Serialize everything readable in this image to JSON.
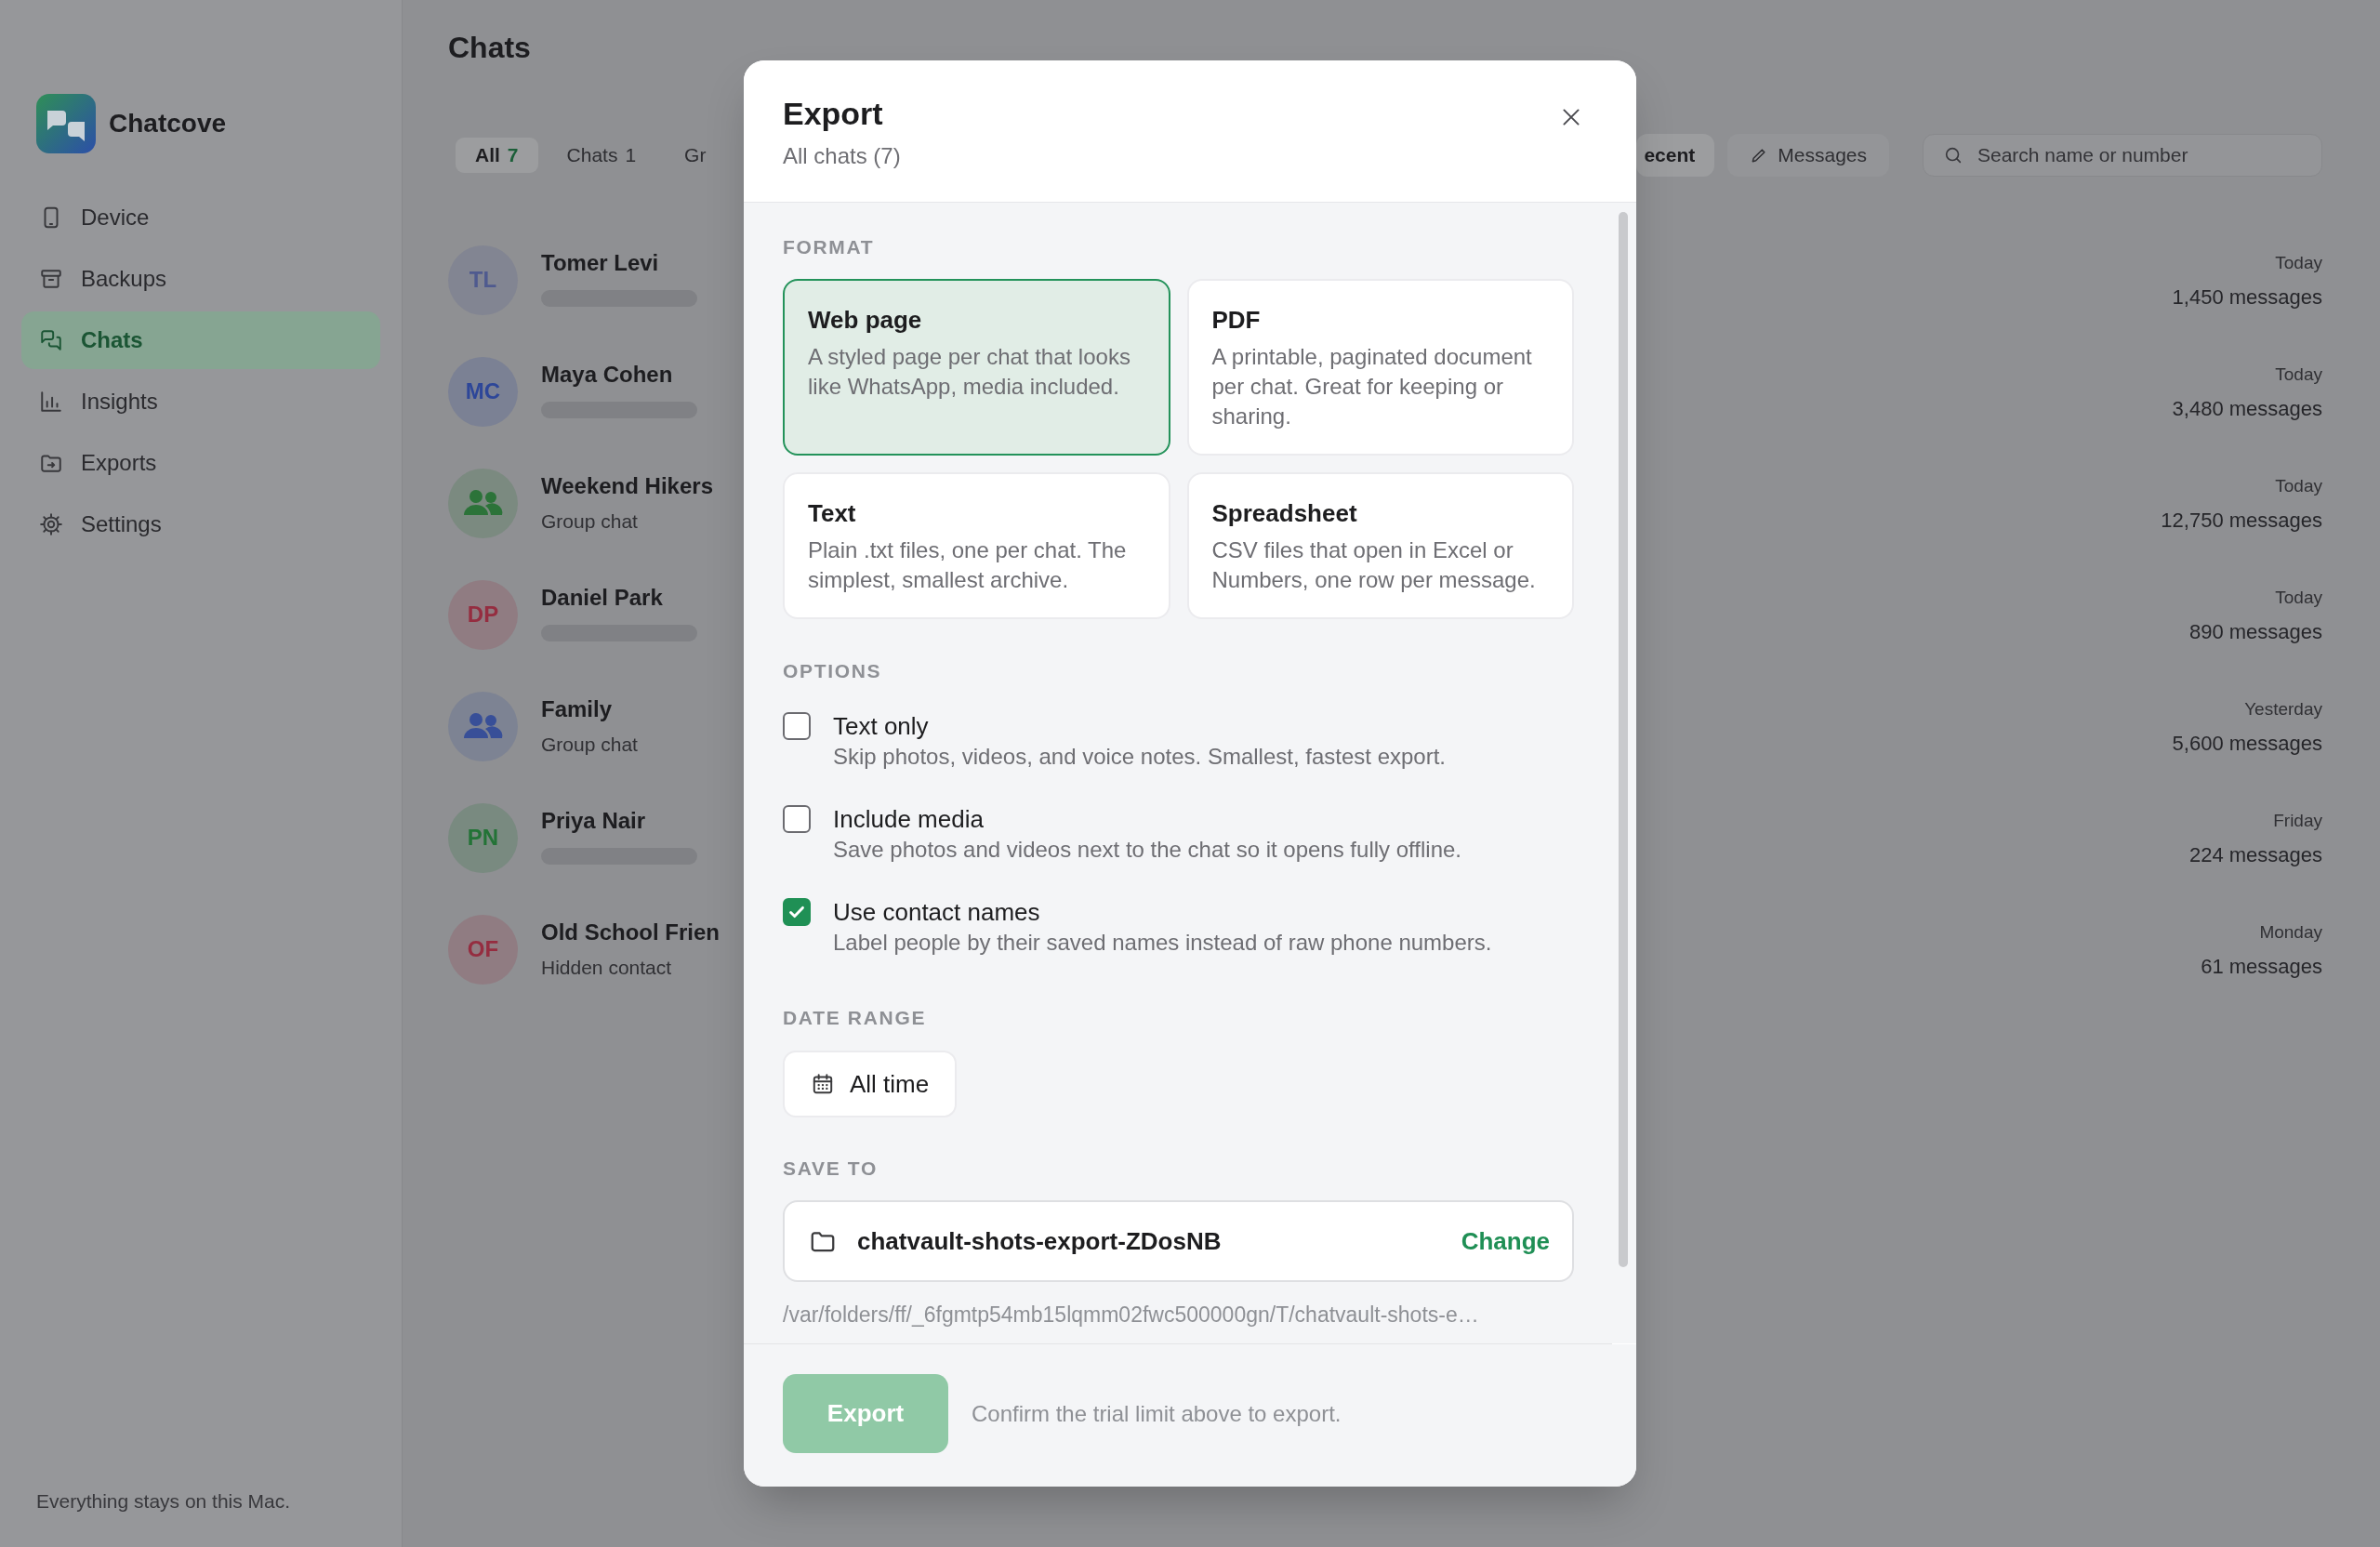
{
  "sidebar": {
    "app_name": "Chatcove",
    "items": [
      {
        "label": "Device",
        "selected": false
      },
      {
        "label": "Backups",
        "selected": false
      },
      {
        "label": "Chats",
        "selected": true
      },
      {
        "label": "Insights",
        "selected": false
      },
      {
        "label": "Exports",
        "selected": false
      },
      {
        "label": "Settings",
        "selected": false
      }
    ],
    "footer": "Everything stays on this Mac."
  },
  "main": {
    "title": "Chats",
    "filters": [
      {
        "label": "All",
        "count": "7",
        "selected": true
      },
      {
        "label": "Chats",
        "count": "1",
        "selected": false
      },
      {
        "label": "Gr",
        "selected": false
      }
    ],
    "sort": [
      {
        "label": "ecent",
        "selected": true
      },
      {
        "label": "Messages",
        "selected": false
      }
    ],
    "search": {
      "placeholder": "Search name or number"
    },
    "chats": [
      {
        "name": "Tomer Levi",
        "avatar": {
          "kind": "initials",
          "text": "TL",
          "color": "#4f5a8f"
        },
        "subtitle": {
          "kind": "blurred"
        },
        "time": "Today",
        "count": "1,450 messages"
      },
      {
        "name": "Maya Cohen",
        "avatar": {
          "kind": "initials",
          "text": "MC",
          "color": "#2d4699"
        },
        "subtitle": {
          "kind": "blurred"
        },
        "time": "Today",
        "count": "3,480 messages"
      },
      {
        "name": "Weekend Hikers",
        "avatar": {
          "kind": "group",
          "color": "#2c7339"
        },
        "subtitle": {
          "kind": "text",
          "text": "Group chat"
        },
        "time": "Today",
        "count": "12,750 messages"
      },
      {
        "name": "Daniel Park",
        "avatar": {
          "kind": "initials",
          "text": "DP",
          "color": "#952d40"
        },
        "subtitle": {
          "kind": "blurred"
        },
        "time": "Today",
        "count": "890 messages"
      },
      {
        "name": "Family",
        "avatar": {
          "kind": "group",
          "color": "#384f98"
        },
        "subtitle": {
          "kind": "text",
          "text": "Group chat"
        },
        "time": "Yesterday",
        "count": "5,600 messages"
      },
      {
        "name": "Priya Nair",
        "avatar": {
          "kind": "initials",
          "text": "PN",
          "color": "#237336"
        },
        "subtitle": {
          "kind": "blurred"
        },
        "time": "Friday",
        "count": "224 messages"
      },
      {
        "name": "Old School Frien",
        "avatar": {
          "kind": "initials",
          "text": "OF",
          "color": "#952d40"
        },
        "subtitle": {
          "kind": "text",
          "text": "Hidden contact"
        },
        "time": "Monday",
        "count": "61 messages"
      }
    ]
  },
  "dialog": {
    "title": "Export",
    "subtitle": "All chats (7)",
    "format": {
      "label": "FORMAT",
      "options": [
        {
          "title": "Web page",
          "description": "A styled page per chat that looks like WhatsApp, media included.",
          "selected": true
        },
        {
          "title": "PDF",
          "description": "A printable, paginated document per chat. Great for keeping or sharing.",
          "selected": false
        },
        {
          "title": "Text",
          "description": "Plain .txt files, one per chat. The simplest, smallest archive.",
          "selected": false
        },
        {
          "title": "Spreadsheet",
          "description": "CSV files that open in Excel or Numbers, one row per message.",
          "selected": false
        }
      ]
    },
    "options": {
      "label": "OPTIONS",
      "items": [
        {
          "label": "Text only",
          "description": "Skip photos, videos, and voice notes. Smallest, fastest export.",
          "checked": false
        },
        {
          "label": "Include media",
          "description": "Save photos and videos next to the chat so it opens fully offline.",
          "checked": false
        },
        {
          "label": "Use contact names",
          "description": "Label people by their saved names instead of raw phone numbers.",
          "checked": true
        }
      ]
    },
    "date_range": {
      "label": "DATE RANGE",
      "value": "All time"
    },
    "save_to": {
      "label": "SAVE TO",
      "folder": "chatvault-shots-export-ZDosNB",
      "action": "Change",
      "path": "/var/folders/ff/_6fgmtp54mb15lqmm02fwc500000gn/T/chatvault-shots-e…"
    },
    "footer": {
      "button": {
        "label": "Export",
        "disabled": true
      },
      "hint": "Confirm the trial limit above to export."
    }
  }
}
